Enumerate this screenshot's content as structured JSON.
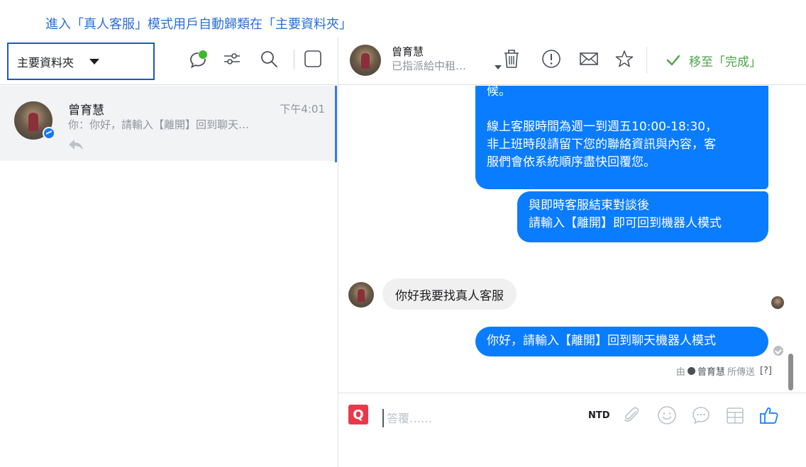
{
  "caption": "進入「真人客服」模式用戶自動歸類在「主要資料夾」",
  "left_toolbar": {
    "folder_label": "主要資料夾",
    "icons": [
      "chat-new-icon",
      "filter-icon",
      "search-icon",
      "select-checkbox-icon"
    ],
    "chat_new_dot_color": "#42b72a"
  },
  "conversation": {
    "name": "曾育慧",
    "time": "下午4:01",
    "preview": "你：你好，請輸入【離開】回到聊天…",
    "replied_icon": "reply-icon",
    "selected_color": "#3578e5"
  },
  "header": {
    "name": "曾育慧",
    "assign_text": "已指派給中租…",
    "icons": [
      "trash-icon",
      "spam-icon",
      "mark-unread-icon",
      "star-icon"
    ],
    "done_label": "移至「完成」",
    "done_color": "#4ca34a"
  },
  "messages": {
    "out_1_line_a": "候。",
    "out_1_line_b": "線上客服時間為週一到週五10:00-18:30，",
    "out_1_line_c": "非上班時段請留下您的聯絡資訊與內容，客",
    "out_1_line_d": "服們會依系統順序盡快回覆您。",
    "out_2_line_a": "與即時客服結束對談後",
    "out_2_line_b": "請輸入【離開】即可回到機器人模式",
    "in_1": "你好我要找真人客服",
    "out_3": "你好，請輸入【離開】回到聊天機器人模式",
    "sent_by_prefix": "由",
    "sent_by_name": "曾育慧",
    "sent_by_suffix": "所傳送",
    "sent_by_help": "[?]",
    "outgoing_color": "#0a7cff",
    "incoming_color": "#f1f0f0"
  },
  "composer": {
    "brand_glyph": "Q",
    "placeholder": "答覆……",
    "currency_label": "NTD",
    "icons": [
      "attachment-icon",
      "emoji-icon",
      "saved-reply-icon",
      "appointment-icon",
      "like-icon"
    ]
  }
}
